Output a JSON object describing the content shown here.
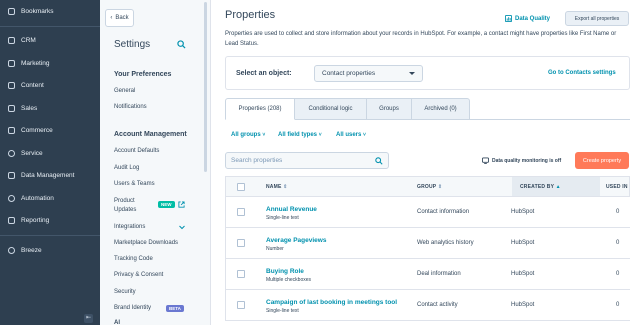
{
  "nav": {
    "items": [
      {
        "label": "Bookmarks"
      },
      {
        "label": "CRM"
      },
      {
        "label": "Marketing"
      },
      {
        "label": "Content"
      },
      {
        "label": "Sales"
      },
      {
        "label": "Commerce"
      },
      {
        "label": "Service"
      },
      {
        "label": "Data Management"
      },
      {
        "label": "Automation"
      },
      {
        "label": "Reporting"
      },
      {
        "label": "Breeze"
      }
    ]
  },
  "settings": {
    "back_label": "Back",
    "title": "Settings",
    "sections": [
      {
        "title": "Your Preferences",
        "items": [
          "General",
          "Notifications"
        ]
      },
      {
        "title": "Account Management",
        "items": [
          "Account Defaults",
          "Audit Log",
          "Users & Teams",
          "Product Updates",
          "Integrations",
          "Marketplace Downloads",
          "Tracking Code",
          "Privacy & Consent",
          "Security",
          "Brand Identity",
          "Al"
        ]
      }
    ],
    "product_updates_line1": "Product",
    "product_updates_line2": "Updates",
    "new_badge": "NEW",
    "beta_badge": "BETA"
  },
  "main": {
    "title": "Properties",
    "description": "Properties are used to collect and store information about your records in HubSpot. For example, a contact might have properties like First Name or Lead Status.",
    "data_quality_label": "Data Quality",
    "export_label": "Export all properties",
    "select_object_label": "Select an object:",
    "object_value": "Contact properties",
    "go_link": "Go to Contacts settings",
    "tabs": [
      {
        "label": "Properties (208)"
      },
      {
        "label": "Conditional logic"
      },
      {
        "label": "Groups"
      },
      {
        "label": "Archived (0)"
      }
    ],
    "filters": [
      {
        "label": "All groups"
      },
      {
        "label": "All field types"
      },
      {
        "label": "All users"
      }
    ],
    "search_placeholder": "Search properties",
    "dq_monitoring": "Data quality monitoring is off",
    "create_label": "Create property",
    "table": {
      "headers": [
        "NAME",
        "GROUP",
        "CREATED BY",
        "USED IN"
      ],
      "rows": [
        {
          "name": "Annual Revenue",
          "type": "Single-line text",
          "group": "Contact information",
          "created_by": "HubSpot",
          "used_in": "0"
        },
        {
          "name": "Average Pageviews",
          "type": "Number",
          "group": "Web analytics history",
          "created_by": "HubSpot",
          "used_in": "0"
        },
        {
          "name": "Buying Role",
          "type": "Multiple checkboxes",
          "group": "Deal information",
          "created_by": "HubSpot",
          "used_in": "0"
        },
        {
          "name": "Campaign of last booking in meetings tool",
          "type": "Single-line text",
          "group": "Contact activity",
          "created_by": "HubSpot",
          "used_in": "0"
        }
      ]
    }
  },
  "colors": {
    "nav_bg": "#2e3f50",
    "link": "#0091ae",
    "accent": "#ff7a59",
    "new_badge": "#00bda5",
    "beta_badge": "#6a78d1"
  }
}
